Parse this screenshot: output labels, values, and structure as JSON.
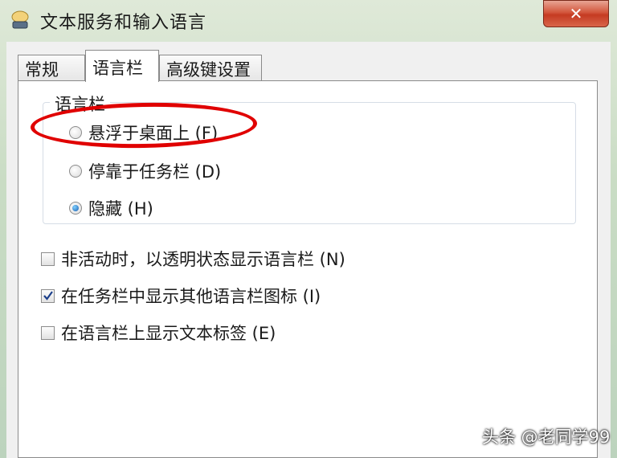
{
  "window": {
    "title": "文本服务和输入语言",
    "close_glyph": "✕"
  },
  "tabs": [
    {
      "label": "常规",
      "active": false
    },
    {
      "label": "语言栏",
      "active": true
    },
    {
      "label": "高级键设置",
      "active": false
    }
  ],
  "language_bar": {
    "group_label": "语言栏",
    "options": [
      {
        "label": "悬浮于桌面上 (F)",
        "checked": false
      },
      {
        "label": "停靠于任务栏 (D)",
        "checked": false
      },
      {
        "label": "隐藏 (H)",
        "checked": true
      }
    ]
  },
  "checkboxes": [
    {
      "label": "非活动时，以透明状态显示语言栏 (N)",
      "checked": false
    },
    {
      "label": "在任务栏中显示其他语言栏图标 (I)",
      "checked": true
    },
    {
      "label": "在语言栏上显示文本标签 (E)",
      "checked": false
    }
  ],
  "watermark": "头条 @老同学99",
  "colors": {
    "highlight": "#e00000",
    "accent": "#1c5fb0"
  }
}
